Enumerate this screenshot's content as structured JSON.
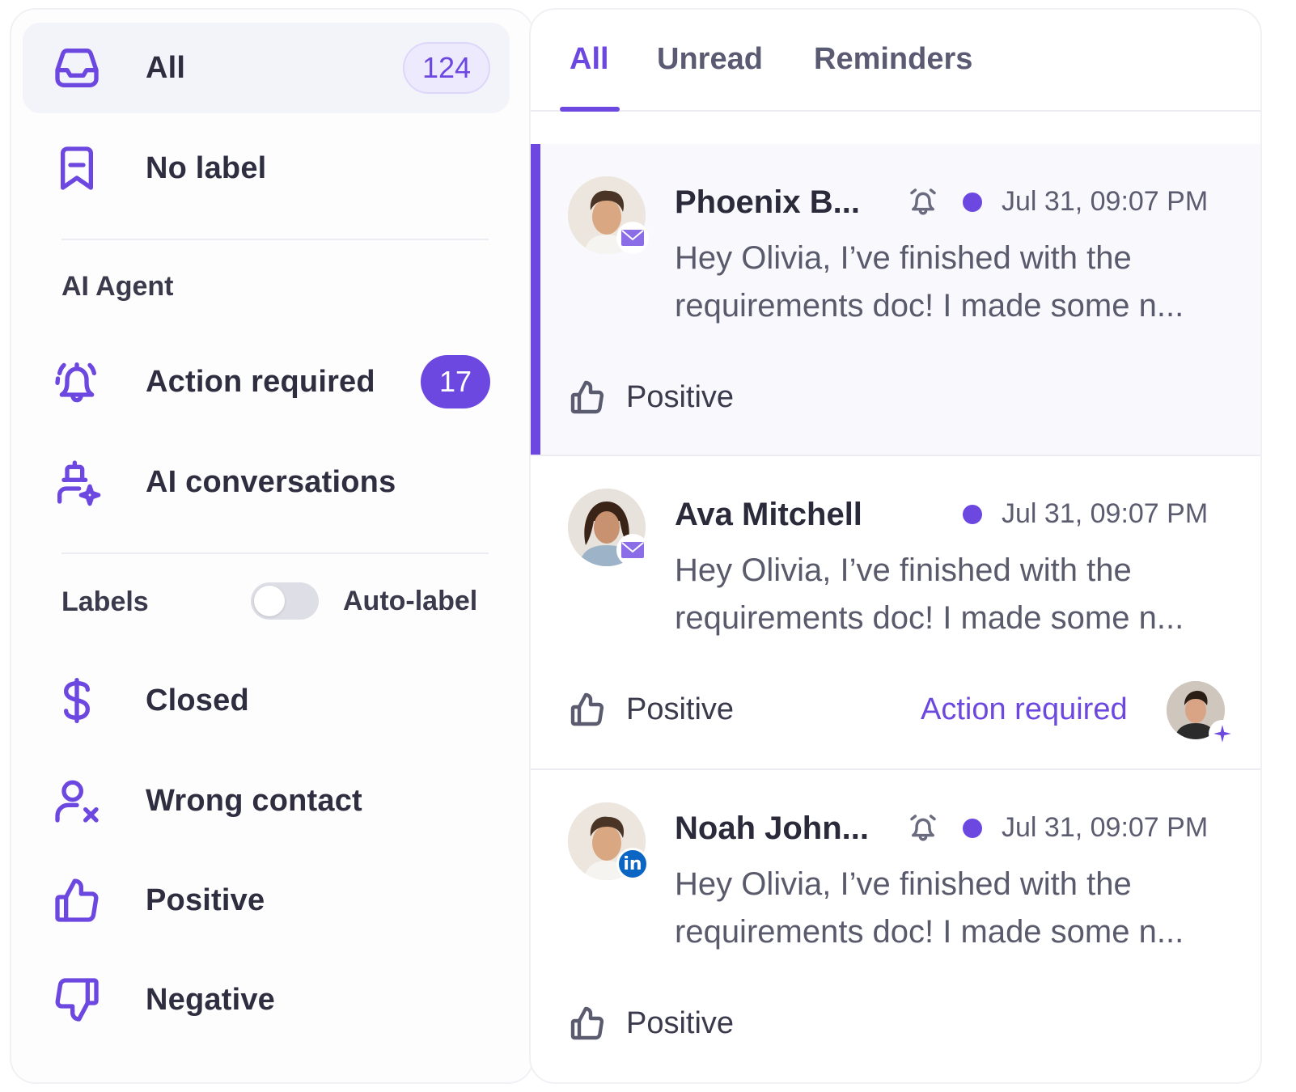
{
  "sidebar": {
    "items": [
      {
        "label": "All",
        "count": "124",
        "icon": "inbox-icon"
      },
      {
        "label": "No label",
        "icon": "bookmark-icon"
      }
    ],
    "ai_agent": {
      "title": "AI Agent",
      "items": [
        {
          "label": "Action required",
          "count": "17",
          "icon": "bell-ringing-icon"
        },
        {
          "label": "AI conversations",
          "icon": "robot-user-sparkle-icon"
        }
      ]
    },
    "labels": {
      "title": "Labels",
      "auto_label": "Auto-label",
      "auto_label_on": false,
      "items": [
        {
          "label": "Closed",
          "icon": "dollar-icon"
        },
        {
          "label": "Wrong contact",
          "icon": "user-x-icon"
        },
        {
          "label": "Positive",
          "icon": "thumbs-up-icon"
        },
        {
          "label": "Negative",
          "icon": "thumbs-down-icon"
        }
      ]
    }
  },
  "tabs": [
    {
      "label": "All",
      "active": true
    },
    {
      "label": "Unread",
      "active": false
    },
    {
      "label": "Reminders",
      "active": false
    }
  ],
  "conversations": [
    {
      "sender": "Phoenix B...",
      "reminder": true,
      "unread": true,
      "time": "Jul 31, 09:07 PM",
      "channel": "email",
      "preview": "Hey Olivia, I’ve finished with the requirements doc! I made some n...",
      "label": "Positive",
      "selected": true
    },
    {
      "sender": "Ava Mitchell",
      "reminder": false,
      "unread": true,
      "time": "Jul 31, 09:07 PM",
      "channel": "email",
      "preview": "Hey Olivia, I’ve finished with the requirements doc! I made some n...",
      "label": "Positive",
      "action": "Action required",
      "selected": false
    },
    {
      "sender": "Noah John...",
      "reminder": true,
      "unread": true,
      "time": "Jul 31, 09:07 PM",
      "channel": "linkedin",
      "channel_badge": "in",
      "preview": "Hey Olivia, I’ve finished with the requirements doc! I made some n...",
      "label": "Positive",
      "selected": false
    }
  ],
  "colors": {
    "accent": "#6c47e0",
    "accent_soft": "#eeeafd",
    "active_bg": "#f3f3fa",
    "linkedin": "#0a66c2"
  }
}
